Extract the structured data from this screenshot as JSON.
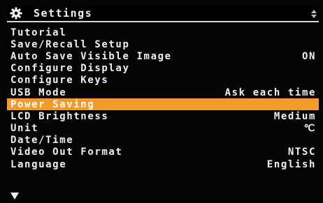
{
  "header": {
    "title": "Settings",
    "left_icon": "gear-icon",
    "right_icon": "up-down-arrows-icon"
  },
  "menu": {
    "items": [
      {
        "label": "Tutorial",
        "value": ""
      },
      {
        "label": "Save/Recall Setup",
        "value": ""
      },
      {
        "label": "Auto Save Visible Image",
        "value": "ON"
      },
      {
        "label": "Configure Display",
        "value": ""
      },
      {
        "label": "Configure Keys",
        "value": ""
      },
      {
        "label": "USB Mode",
        "value": "Ask each time"
      },
      {
        "label": "Power Saving",
        "value": ""
      },
      {
        "label": "LCD Brightness",
        "value": "Medium"
      },
      {
        "label": "Unit",
        "value": "℃"
      },
      {
        "label": "Date/Time",
        "value": ""
      },
      {
        "label": "Video Out Format",
        "value": "NTSC"
      },
      {
        "label": "Language",
        "value": "English"
      }
    ],
    "selected_index": 6
  },
  "footer": {
    "scroll_icon": "down-triangle-icon"
  },
  "colors": {
    "background": "#000000",
    "text": "#f0f0f0",
    "highlight": "#f39a2a"
  }
}
